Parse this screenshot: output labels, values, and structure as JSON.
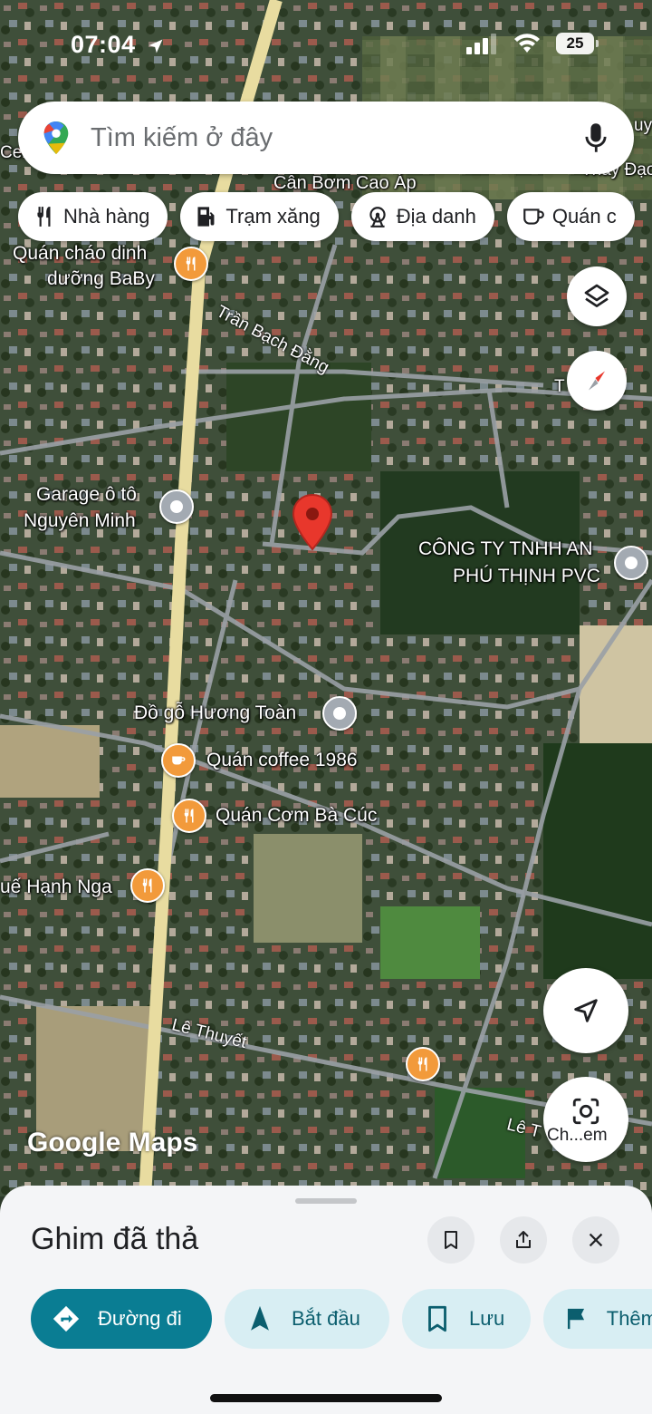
{
  "status_bar": {
    "time": "07:04",
    "battery": "25"
  },
  "search": {
    "placeholder": "Tìm kiếm ở đây"
  },
  "chips": [
    {
      "label": "Nhà hàng",
      "icon": "fork-knife-icon"
    },
    {
      "label": "Trạm xăng",
      "icon": "gas-pump-icon"
    },
    {
      "label": "Địa danh",
      "icon": "ferris-wheel-icon"
    },
    {
      "label": "Quán c",
      "icon": "coffee-cup-icon"
    }
  ],
  "map": {
    "places": {
      "can_bom": "Cân Bơm Cao Áp",
      "quan_chao_1": "Quán cháo dinh",
      "quan_chao_2": "dưỡng BaBy",
      "garage_1": "Garage ô tô",
      "garage_2": "Nguyên Minh",
      "cong_ty_1": "CÔNG TY TNHH AN",
      "cong_ty_2": "PHÚ THỊNH PVC",
      "do_go": "Đồ gỗ Hương Toàn",
      "coffee": "Quán coffee 1986",
      "quan_com": "Quán Cơm Bà Cúc",
      "hanh_nga": "uế Hạnh Nga",
      "edge_right_1": "uy",
      "edge_right_2": "Thay Đạo L",
      "edge_left": "Cel"
    },
    "roads": {
      "tran_bach_dang": "Trần Bạch Đằng",
      "tran_bach_dang_right": "T         ch",
      "le_thuyet": "Lê Thuyết",
      "le_t": "Lê T"
    },
    "logo": "Google Maps"
  },
  "fabs": {
    "camera_label": "Ch...em"
  },
  "sheet": {
    "title": "Ghim đã thả",
    "actions": [
      {
        "label": "Đường đi",
        "icon": "directions-icon"
      },
      {
        "label": "Bắt đầu",
        "icon": "navigation-arrow-icon"
      },
      {
        "label": "Lưu",
        "icon": "bookmark-icon"
      },
      {
        "label": "Thêm",
        "icon": "flag-icon"
      }
    ]
  },
  "colors": {
    "primary_button": "#0a7d93",
    "secondary_button": "#d8eef3",
    "pin": "#e8372c",
    "poi_food": "#f29a3b"
  }
}
